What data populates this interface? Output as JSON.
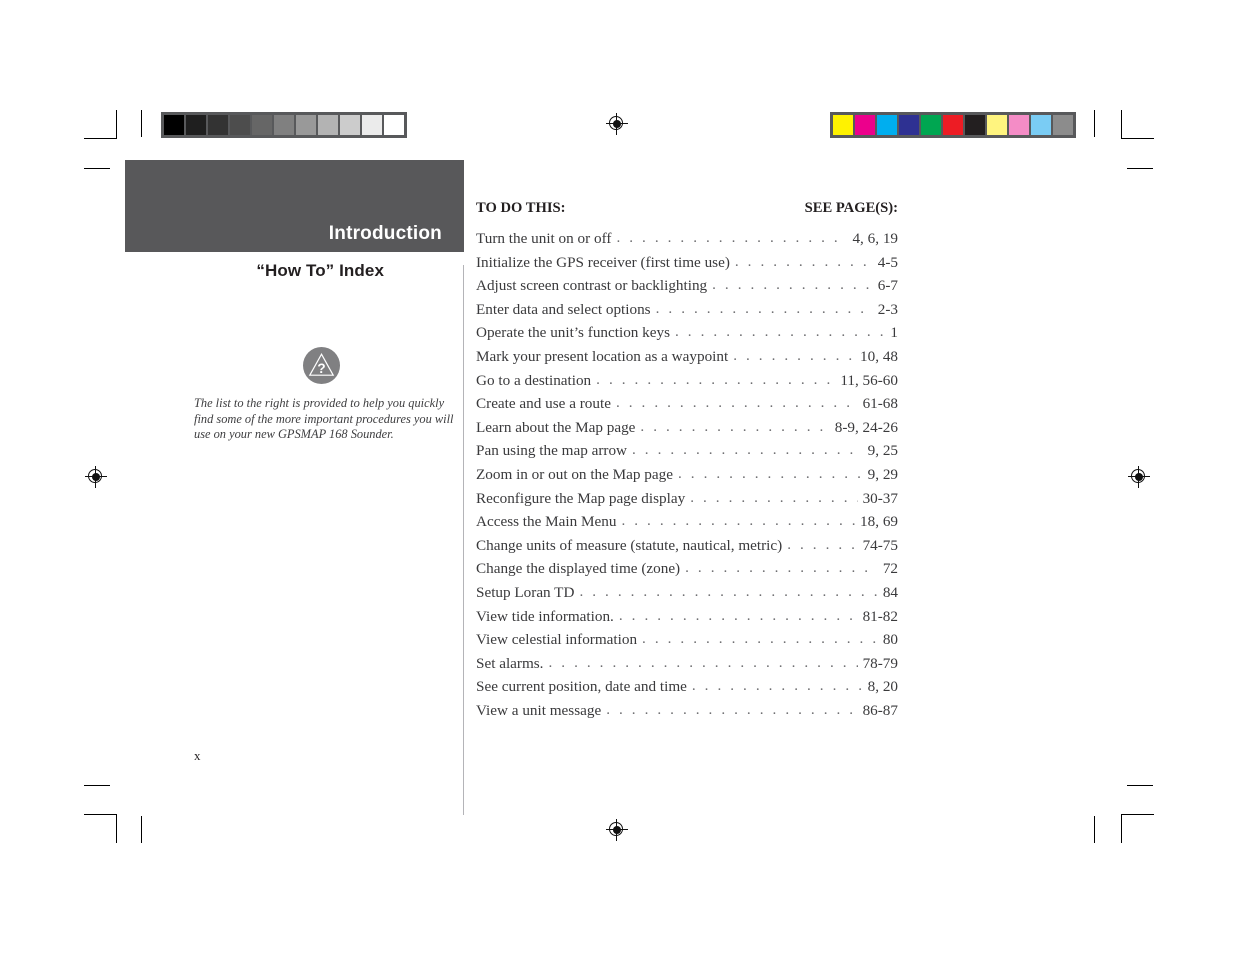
{
  "page": {
    "folio": "x"
  },
  "sidebar": {
    "chapter_title": "Introduction",
    "section_title": "“How To” Index",
    "note_icon": "question-in-triangle-icon",
    "note_text": "The list to the right is provided to help you quickly find some of the more important procedures you will use on your new GPSMAP 168 Sounder.",
    "band_color": "#58585a"
  },
  "index": {
    "header_left": "TO DO THIS:",
    "header_right": "SEE PAGE(S):",
    "leader_dots": ". . . . . . . . . . . . . . . . . . . . . . . . . . . . . . . . . . . . . . . . . . . . . . . . . . . . . . . . . . . . . . . . . . . . . . . . . . . . . . . . . . .",
    "rows": [
      {
        "label": "Turn the unit on or off",
        "pages": "4, 6, 19"
      },
      {
        "label": "Initialize the GPS receiver (first time use)",
        "pages": "4-5"
      },
      {
        "label": "Adjust screen contrast or backlighting",
        "pages": "6-7"
      },
      {
        "label": "Enter data and select options",
        "pages": "2-3"
      },
      {
        "label": "Operate the unit’s function keys",
        "pages": "1"
      },
      {
        "label": "Mark your present location as a waypoint",
        "pages": "10, 48"
      },
      {
        "label": "Go to a destination",
        "pages": "11, 56-60"
      },
      {
        "label": "Create and use a route",
        "pages": "61-68"
      },
      {
        "label": "Learn about the Map page",
        "pages": "8-9, 24-26"
      },
      {
        "label": "Pan using the map arrow",
        "pages": "9, 25"
      },
      {
        "label": "Zoom in or out on the Map page",
        "pages": "9, 29"
      },
      {
        "label": "Reconfigure the Map page display",
        "pages": "30-37"
      },
      {
        "label": "Access the Main Menu",
        "pages": "18, 69"
      },
      {
        "label": "Change units of measure (statute, nautical, metric)",
        "pages": "74-75"
      },
      {
        "label": "Change the displayed time (zone)",
        "pages": "72"
      },
      {
        "label": "Setup Loran TD",
        "pages": "84"
      },
      {
        "label": "View tide information.",
        "pages": "81-82"
      },
      {
        "label": "View celestial information",
        "pages": "80"
      },
      {
        "label": "Set alarms.",
        "pages": "78-79"
      },
      {
        "label": "See current position, date and time",
        "pages": "8, 20"
      },
      {
        "label": "View a unit message",
        "pages": "86-87"
      }
    ]
  },
  "prepress": {
    "grayscale_bar": {
      "name": "grayscale-calibration-bar",
      "swatches": [
        "#000000",
        "#1f1f1f",
        "#333333",
        "#4d4d4d",
        "#666666",
        "#808080",
        "#999999",
        "#b3b3b3",
        "#cccccc",
        "#ebebeb",
        "#ffffff"
      ]
    },
    "color_bar": {
      "name": "color-calibration-bar",
      "swatches": [
        "#fff200",
        "#ec008c",
        "#00aeef",
        "#2e3192",
        "#00a651",
        "#ed1c24",
        "#231f20",
        "#fff47f",
        "#f48cc6",
        "#7accf4",
        "#8c8c8c"
      ]
    },
    "registration_marks": 4,
    "crop_marks": 8
  }
}
